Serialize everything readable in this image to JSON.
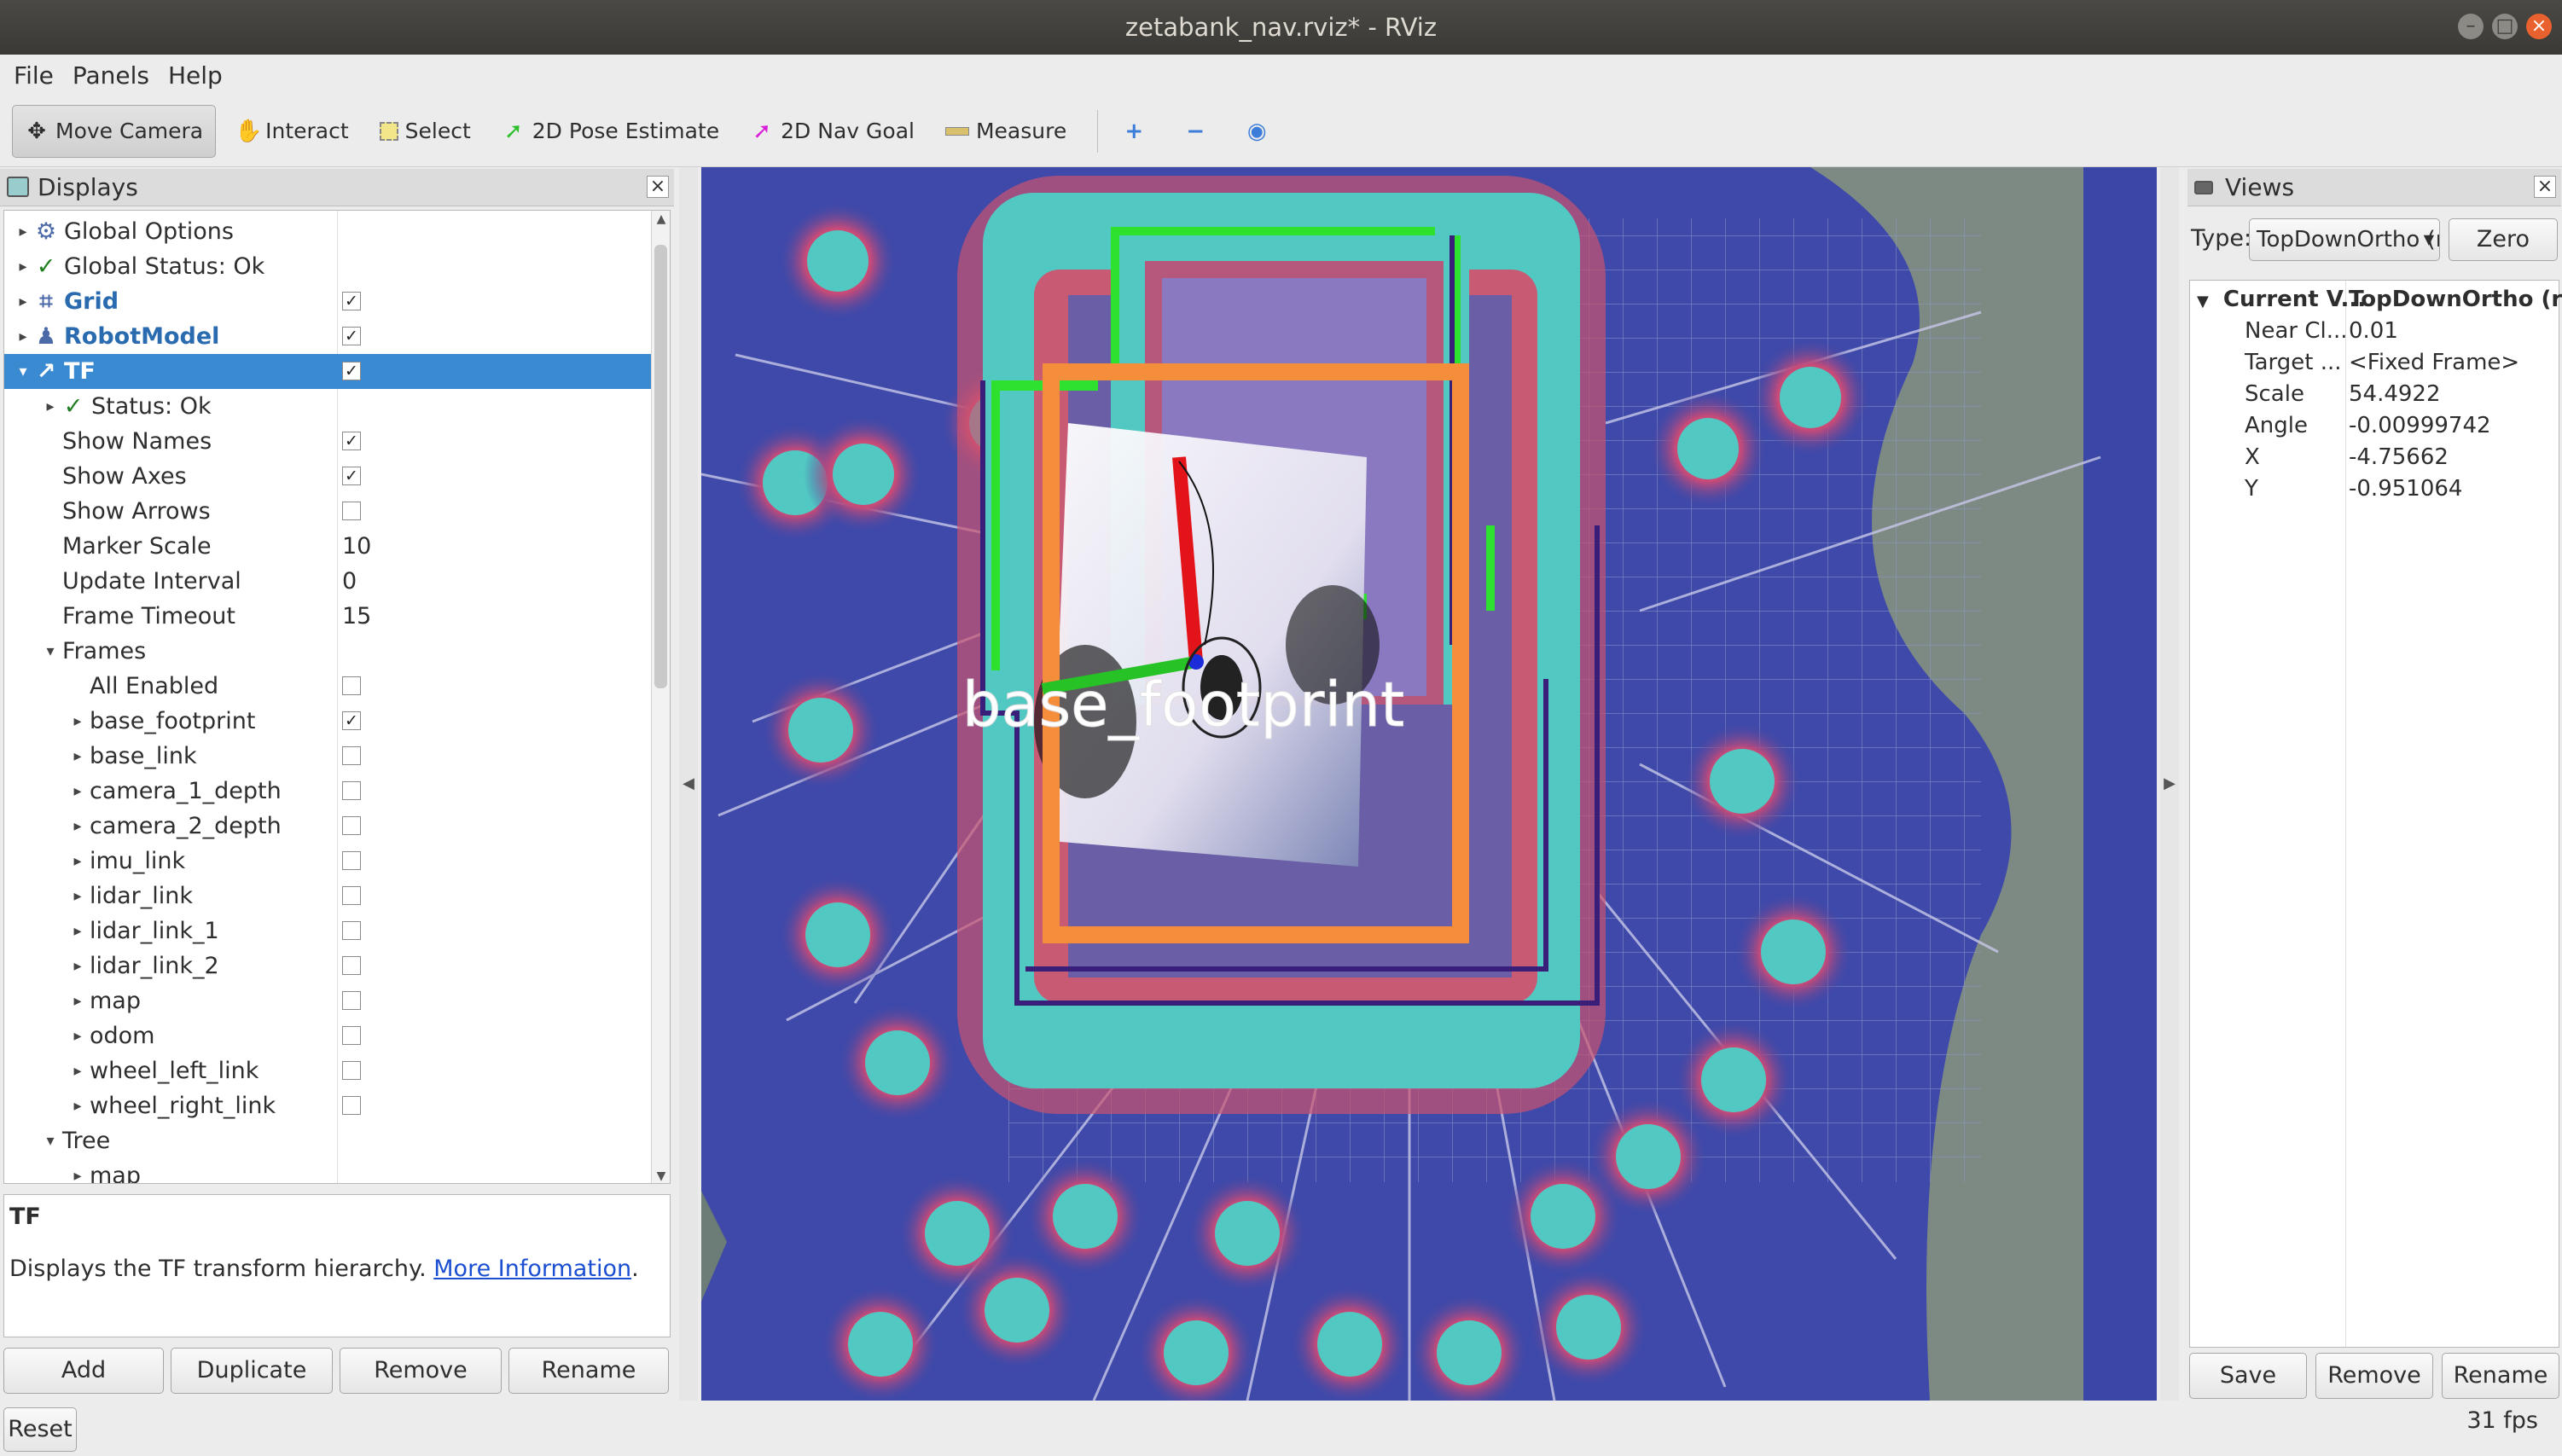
{
  "window": {
    "title": "zetabank_nav.rviz* - RViz",
    "buttons": [
      "–",
      "□",
      "×"
    ]
  },
  "menu": [
    "File",
    "Panels",
    "Help"
  ],
  "toolbar": {
    "tools": [
      {
        "label": "Move Camera",
        "icon": "move-camera-icon"
      },
      {
        "label": "Interact",
        "icon": "hand-icon"
      },
      {
        "label": "Select",
        "icon": "select-box-icon"
      },
      {
        "label": "2D Pose Estimate",
        "icon": "green-arrow-icon"
      },
      {
        "label": "2D Nav Goal",
        "icon": "pink-arrow-icon"
      },
      {
        "label": "Measure",
        "icon": "ruler-icon"
      }
    ],
    "extra_icons": [
      "plus-icon",
      "minus-icon",
      "camera-eye-icon"
    ]
  },
  "displays": {
    "title": "Displays",
    "rows": [
      {
        "label": "Global Options",
        "depth": 0,
        "arrow": "▸",
        "icon": "⚙"
      },
      {
        "label": "Global Status: Ok",
        "depth": 0,
        "arrow": "▸",
        "icon": "✓"
      },
      {
        "label": "Grid",
        "depth": 0,
        "arrow": "▸",
        "icon": "⌗",
        "checked": true,
        "bold": true
      },
      {
        "label": "RobotModel",
        "depth": 0,
        "arrow": "▸",
        "icon": "♟",
        "checked": true,
        "bold": true
      },
      {
        "label": "TF",
        "depth": 0,
        "arrow": "▾",
        "icon": "↗",
        "checked": true,
        "bold": true,
        "selected": true
      },
      {
        "label": "Status: Ok",
        "depth": 1,
        "arrow": "▸",
        "icon": "✓"
      },
      {
        "label": "Show Names",
        "depth": 1,
        "checked": true
      },
      {
        "label": "Show Axes",
        "depth": 1,
        "checked": true
      },
      {
        "label": "Show Arrows",
        "depth": 1,
        "checked": false
      },
      {
        "label": "Marker Scale",
        "depth": 1,
        "value": "10"
      },
      {
        "label": "Update Interval",
        "depth": 1,
        "value": "0"
      },
      {
        "label": "Frame Timeout",
        "depth": 1,
        "value": "15"
      },
      {
        "label": "Frames",
        "depth": 1,
        "arrow": "▾"
      },
      {
        "label": "All Enabled",
        "depth": 2,
        "checked": false
      },
      {
        "label": "base_footprint",
        "depth": 2,
        "arrow": "▸",
        "checked": true
      },
      {
        "label": "base_link",
        "depth": 2,
        "arrow": "▸",
        "checked": false
      },
      {
        "label": "camera_1_depth",
        "depth": 2,
        "arrow": "▸",
        "checked": false
      },
      {
        "label": "camera_2_depth",
        "depth": 2,
        "arrow": "▸",
        "checked": false
      },
      {
        "label": "imu_link",
        "depth": 2,
        "arrow": "▸",
        "checked": false
      },
      {
        "label": "lidar_link",
        "depth": 2,
        "arrow": "▸",
        "checked": false
      },
      {
        "label": "lidar_link_1",
        "depth": 2,
        "arrow": "▸",
        "checked": false
      },
      {
        "label": "lidar_link_2",
        "depth": 2,
        "arrow": "▸",
        "checked": false
      },
      {
        "label": "map",
        "depth": 2,
        "arrow": "▸",
        "checked": false
      },
      {
        "label": "odom",
        "depth": 2,
        "arrow": "▸",
        "checked": false
      },
      {
        "label": "wheel_left_link",
        "depth": 2,
        "arrow": "▸",
        "checked": false
      },
      {
        "label": "wheel_right_link",
        "depth": 2,
        "arrow": "▸",
        "checked": false
      },
      {
        "label": "Tree",
        "depth": 1,
        "arrow": "▾"
      },
      {
        "label": "map",
        "depth": 2,
        "arrow": "▸"
      }
    ],
    "description": {
      "title": "TF",
      "text": "Displays the TF transform hierarchy.",
      "link": "More Information",
      "suffix": "."
    },
    "buttons": {
      "add": "Add",
      "duplicate": "Duplicate",
      "remove": "Remove",
      "rename": "Rename"
    },
    "reset": "Reset"
  },
  "viewport": {
    "frame_label": "base_footprint"
  },
  "views": {
    "title": "Views",
    "type_label": "Type:",
    "type_value": "TopDownOrtho (rviz)",
    "zero": "Zero",
    "current": {
      "label": "Current V...",
      "value": "TopDownOrtho (rviz)"
    },
    "props": [
      {
        "name": "Near Cl...",
        "value": "0.01"
      },
      {
        "name": "Target ...",
        "value": "<Fixed Frame>"
      },
      {
        "name": "Scale",
        "value": "54.4922"
      },
      {
        "name": "Angle",
        "value": "-0.00999742"
      },
      {
        "name": "X",
        "value": "-4.75662"
      },
      {
        "name": "Y",
        "value": "-0.951064"
      }
    ],
    "buttons": {
      "save": "Save",
      "remove": "Remove",
      "rename": "Rename"
    }
  },
  "status": {
    "fps": "31 fps"
  },
  "colors": {
    "selection": "#3a8ad1",
    "map_background": "#3e49a9",
    "inflation": "#52c8c3",
    "robot_box": "#f58e3b"
  }
}
